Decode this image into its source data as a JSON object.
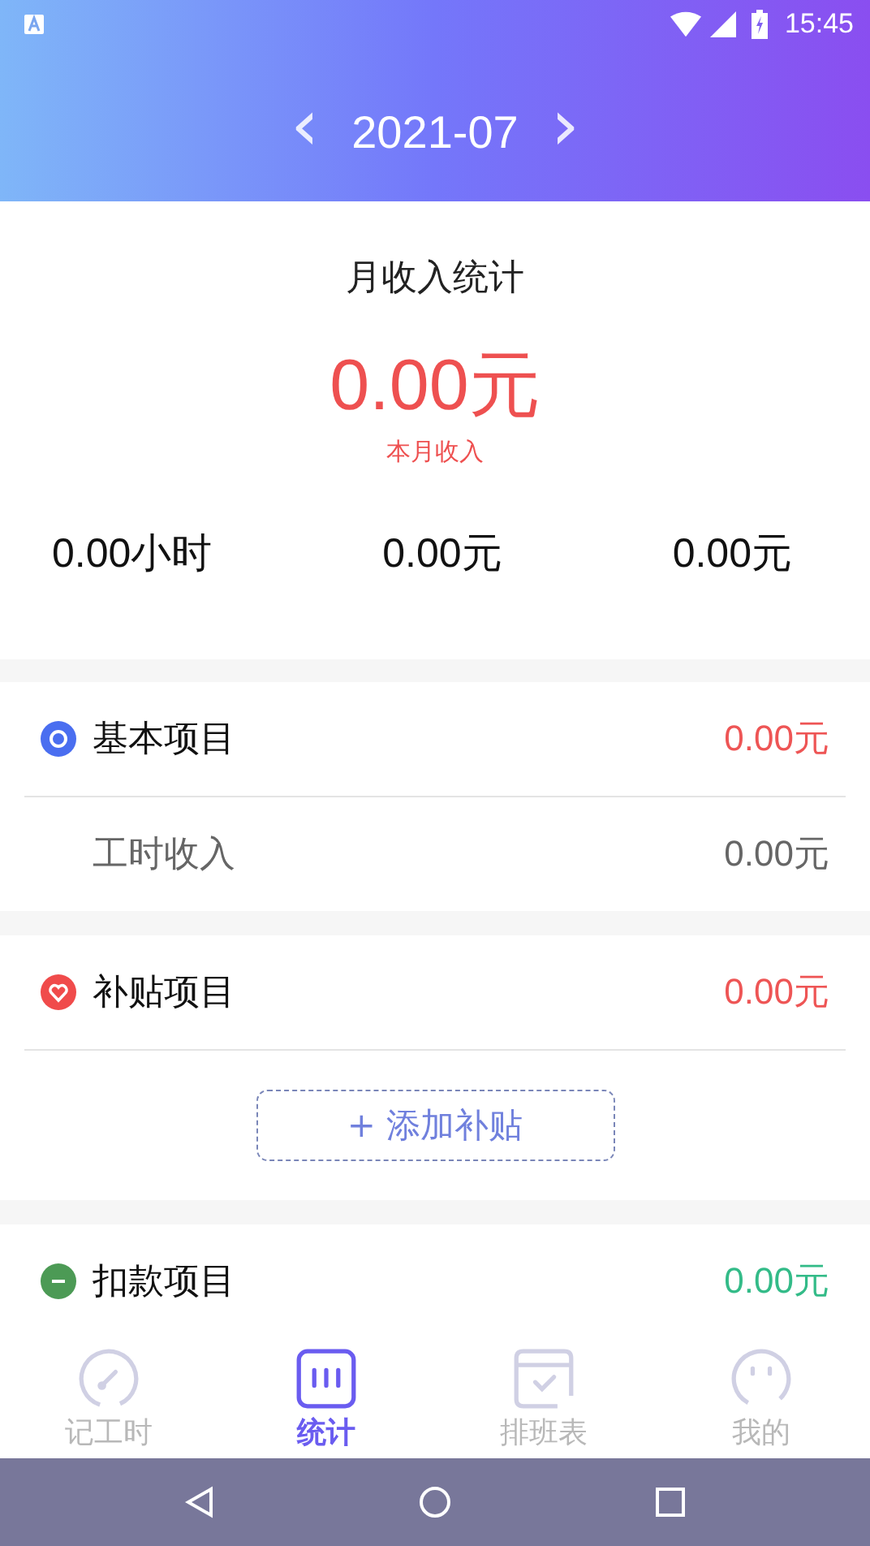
{
  "status_bar": {
    "time": "15:45"
  },
  "header": {
    "month": "2021-07",
    "prev": "‹",
    "next": "›"
  },
  "summary": {
    "title": "月收入统计",
    "amount": "0.00元",
    "caption": "本月收入",
    "stats": [
      "0.00小时",
      "0.00元",
      "0.00元"
    ]
  },
  "sections": [
    {
      "kind": "basic",
      "title": "基本项目",
      "amount": "0.00元",
      "color": "#ee5555",
      "rows": [
        {
          "label": "工时收入",
          "value": "0.00元"
        }
      ]
    },
    {
      "kind": "subsidy",
      "title": "补贴项目",
      "amount": "0.00元",
      "color": "#ee5555",
      "add_button": "+ 添加补贴"
    },
    {
      "kind": "deduction",
      "title": "扣款项目",
      "amount": "0.00元",
      "color": "#33bb88"
    }
  ],
  "tabs": [
    {
      "kind": "clock",
      "label": "记工时",
      "selected": false
    },
    {
      "kind": "chart",
      "label": "统计",
      "selected": true
    },
    {
      "kind": "calendar",
      "label": "排班表",
      "selected": false
    },
    {
      "kind": "face",
      "label": "我的",
      "selected": false
    }
  ]
}
